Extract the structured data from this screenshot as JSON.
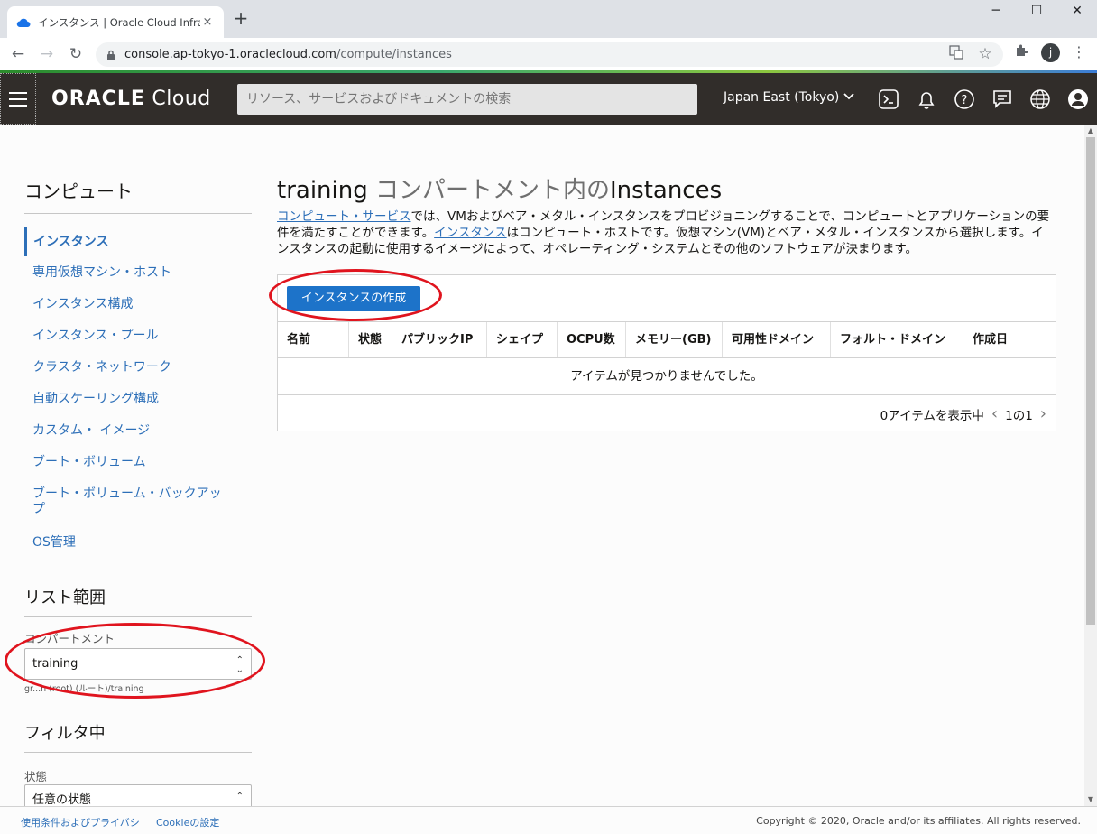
{
  "browser": {
    "tab_title": "インスタンス | Oracle Cloud Infrastru",
    "tab_close": "×",
    "new_tab": "+",
    "window_controls": {
      "minimize": "─",
      "maximize": "☐",
      "close": "✕"
    },
    "url_host": "console.ap-tokyo-1.oraclecloud.com",
    "url_path": "/compute/instances",
    "profile_initial": "j"
  },
  "header": {
    "logo_brand": "ORACLE",
    "logo_product": "Cloud",
    "search_placeholder": "リソース、サービスおよびドキュメントの検索",
    "region": "Japan East (Tokyo)",
    "icons": [
      "cloud-shell-icon",
      "bell-icon",
      "help-icon",
      "chat-icon",
      "globe-icon",
      "profile-icon"
    ]
  },
  "sidebar": {
    "title": "コンピュート",
    "items": [
      {
        "label": "インスタンス",
        "active": true
      },
      {
        "label": "専用仮想マシン・ホスト"
      },
      {
        "label": "インスタンス構成"
      },
      {
        "label": "インスタンス・プール"
      },
      {
        "label": "クラスタ・ネットワーク"
      },
      {
        "label": "自動スケーリング構成"
      },
      {
        "label": "カスタム・ イメージ"
      },
      {
        "label": "ブート・ボリューム"
      },
      {
        "label": "ブート・ボリューム・バックアップ"
      },
      {
        "label": "OS管理"
      }
    ],
    "list_scope_title": "リスト範囲",
    "compartment_label": "コンパートメント",
    "compartment_value": "training",
    "compartment_path": "gr...h (root) (ルート)/training",
    "filter_title": "フィルタ中",
    "state_label": "状態",
    "state_value": "任意の状態"
  },
  "main": {
    "title_compartment": "training",
    "title_middle": " コンパートメント内の",
    "title_resource": "Instances",
    "desc_link1": "コンピュート・サービス",
    "desc_text1": "では、VMおよびベア・メタル・インスタンスをプロビジョニングすることで、コンピュートとアプリケーションの要件を満たすことができます。",
    "desc_link2": "インスタンス",
    "desc_text2": "はコンピュート・ホストです。仮想マシン(VM)とベア・メタル・インスタンスから選択します。インスタンスの起動に使用するイメージによって、オペレーティング・システムとその他のソフトウェアが決まります。",
    "create_button": "インスタンスの作成",
    "columns": [
      "名前",
      "状態",
      "パブリックIP",
      "シェイプ",
      "OCPU数",
      "メモリー(GB)",
      "可用性ドメイン",
      "フォルト・ドメイン",
      "作成日"
    ],
    "empty_message": "アイテムが見つかりませんでした。",
    "items_shown": "0アイテムを表示中",
    "page_indicator": "1の1"
  },
  "footer": {
    "terms": "使用条件およびプライバシ",
    "cookie": "Cookieの設定",
    "copyright": "Copyright © 2020, Oracle and/or its affiliates. All rights reserved."
  },
  "colors": {
    "header_bg": "#312d2a",
    "link": "#2d6fb8",
    "primary_button": "#1d73c9",
    "annotation_red": "#e0141e"
  }
}
